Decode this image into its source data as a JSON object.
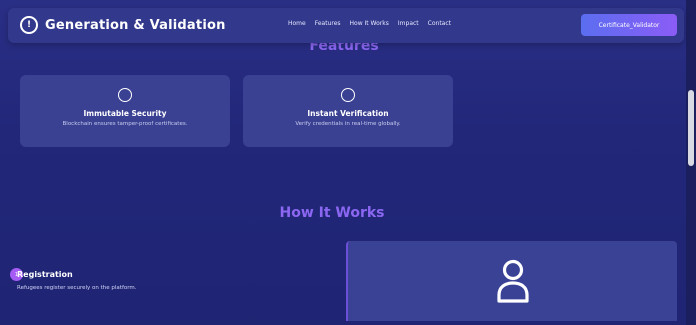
{
  "header": {
    "brand_icon_glyph": "!",
    "brand_title": "Generation & Validation",
    "nav": [
      "Home",
      "Features",
      "How It Works",
      "Impact",
      "Contact"
    ],
    "cta_label": "Certificate_Validator"
  },
  "features": {
    "title": "Features",
    "cards": [
      {
        "title": "Immutable Security",
        "description": "Blockchain ensures tamper-proof certificates.",
        "icon": "circle-icon"
      },
      {
        "title": "Instant Verification",
        "description": "Verify credentials in real-time globally.",
        "icon": "circle-icon"
      }
    ]
  },
  "how_it_works": {
    "title": "How It Works",
    "step": {
      "number": "1",
      "title": "Registration",
      "description": "Refugees register securely on the platform.",
      "icon": "user-icon"
    }
  },
  "colors": {
    "accent": "#8b67f2",
    "background": "#24287a",
    "card": "#3a4192",
    "cta_start": "#5b6ef0",
    "cta_end": "#8b5cf6"
  }
}
